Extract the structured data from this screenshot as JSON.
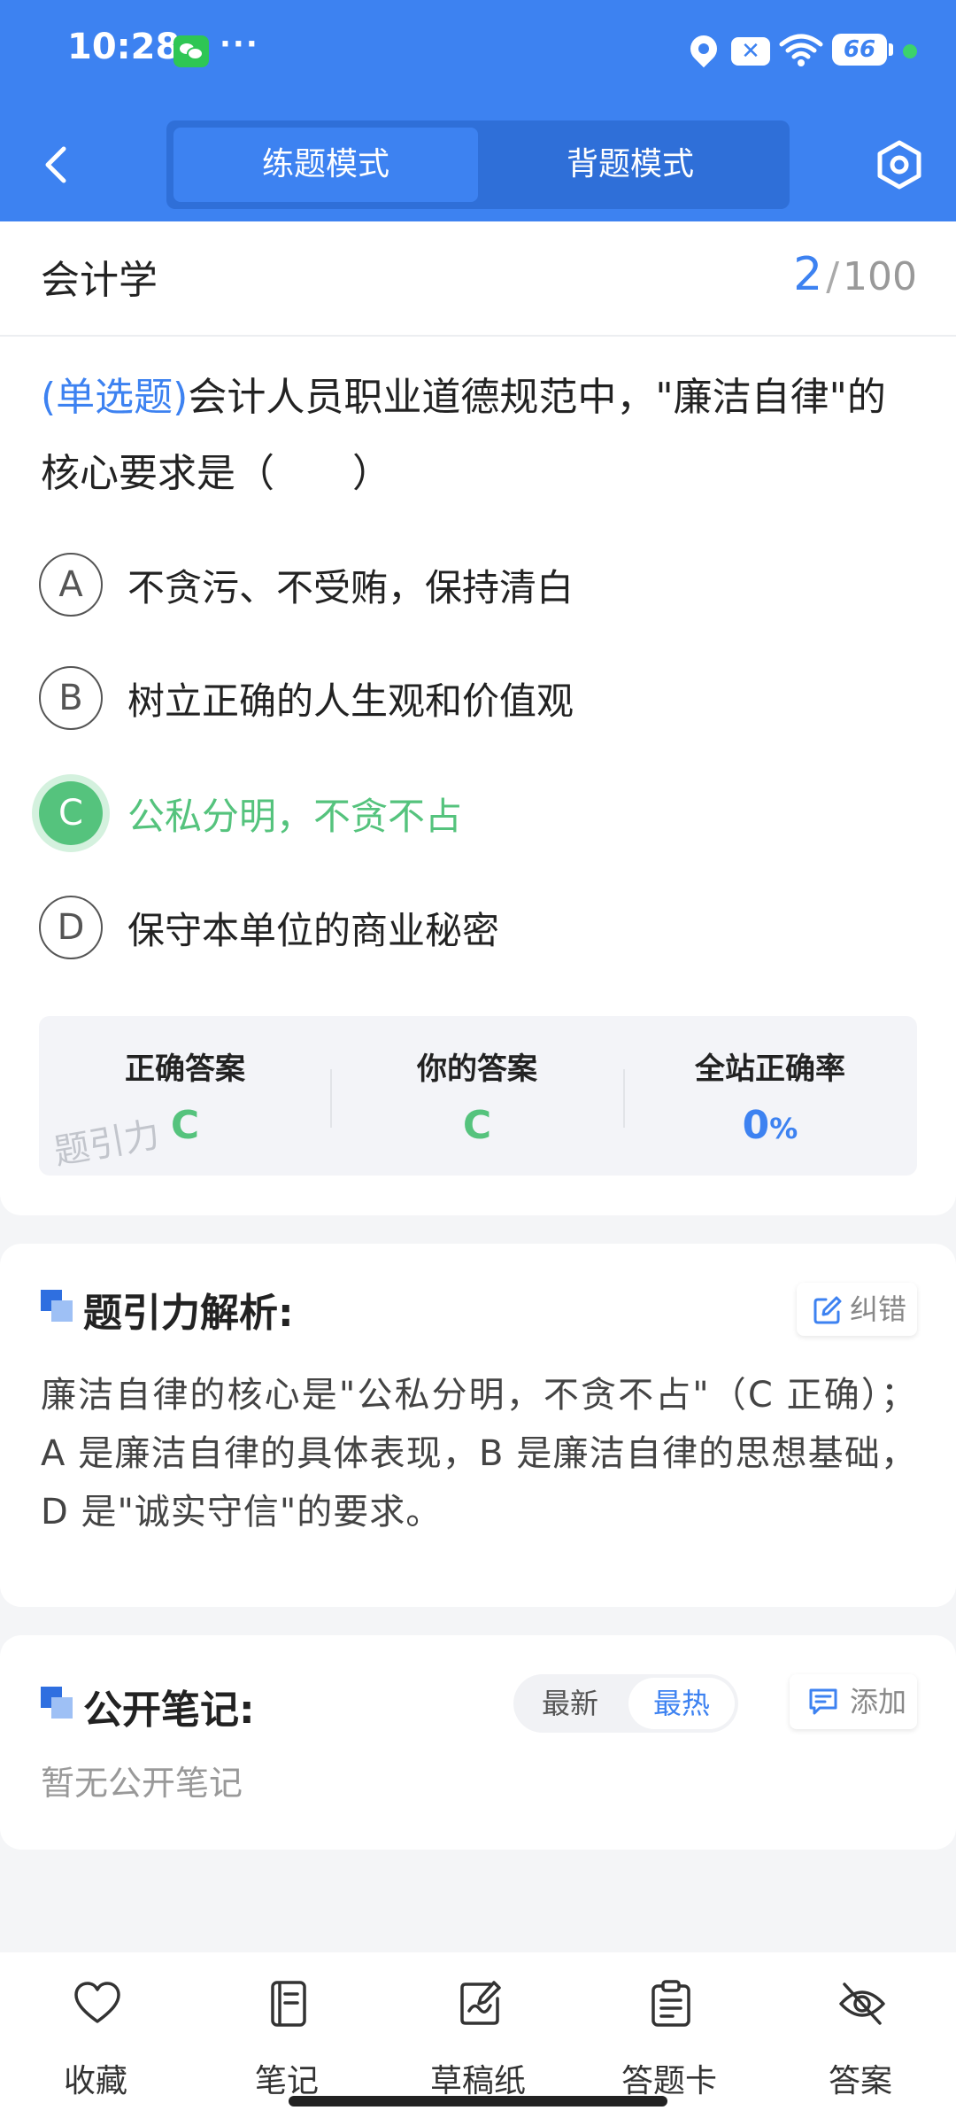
{
  "status_bar": {
    "time": "10:28",
    "dots": "···",
    "battery": "66"
  },
  "header": {
    "tabs": [
      {
        "label": "练题模式",
        "active": true
      },
      {
        "label": "背题模式",
        "active": false
      }
    ]
  },
  "question": {
    "subject": "会计学",
    "current": "2",
    "separator": "/",
    "total": "100",
    "type": "(单选题)",
    "text": "会计人员职业道德规范中，\"廉洁自律\"的核心要求是（　　）",
    "options": [
      {
        "letter": "A",
        "text": "不贪污、不受贿，保持清白"
      },
      {
        "letter": "B",
        "text": "树立正确的人生观和价值观"
      },
      {
        "letter": "C",
        "text": "公私分明，不贪不占"
      },
      {
        "letter": "D",
        "text": "保守本单位的商业秘密"
      }
    ]
  },
  "stats": {
    "correct_label": "正确答案",
    "correct_value": "C",
    "yours_label": "你的答案",
    "yours_value": "C",
    "rate_label": "全站正确率",
    "rate_value": "0",
    "rate_unit": "%",
    "watermark": "题引力"
  },
  "analysis": {
    "title": "题引力解析:",
    "correct_btn": "纠错",
    "text": "廉洁自律的核心是\"公私分明，不贪不占\"（C 正确）；A 是廉洁自律的具体表现，B 是廉洁自律的思想基础，D 是\"诚实守信\"的要求。"
  },
  "notes": {
    "title": "公开笔记:",
    "sort_newest": "最新",
    "sort_hot": "最热",
    "add_btn": "添加",
    "empty": "暂无公开笔记"
  },
  "bottom_nav": {
    "favorite": "收藏",
    "notes": "笔记",
    "draft": "草稿纸",
    "answer_card": "答题卡",
    "answer": "答案"
  },
  "colors": {
    "primary": "#3d82f1",
    "correct": "#55c37d"
  }
}
